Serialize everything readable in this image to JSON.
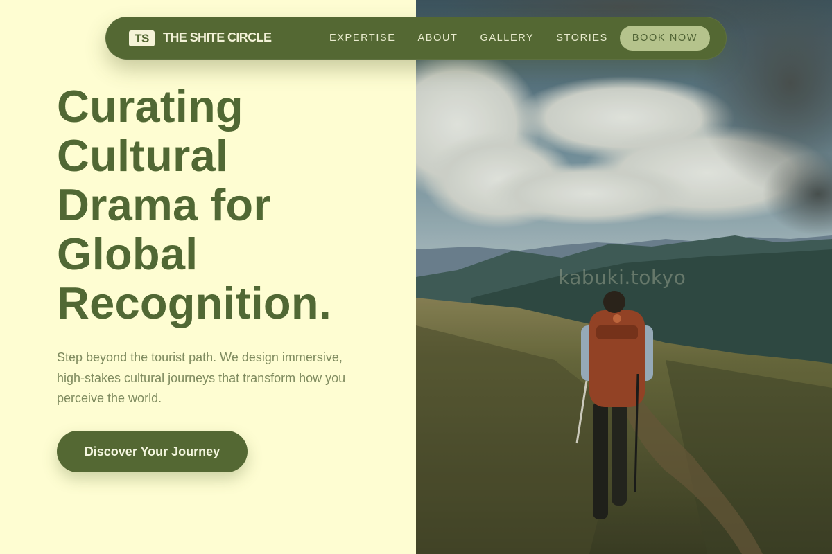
{
  "nav": {
    "logo_initials": "TS",
    "brand": "THE SHITE CIRCLE",
    "links": [
      "EXPERTISE",
      "ABOUT",
      "GALLERY",
      "STORIES"
    ],
    "book_label": "BOOK NOW"
  },
  "hero": {
    "headline_lines": [
      "Curating",
      "Cultural",
      "Drama for",
      "Global",
      "Recognition."
    ],
    "subtext": "Step beyond the tourist path. We design immersive, high-stakes cultural journeys that transform how you perceive the world.",
    "cta_label": "Discover Your Journey",
    "image_watermark": "kabuki.tokyo"
  },
  "colors": {
    "page_background": "#fefdd2",
    "brand_green": "#546833",
    "accent_sage": "#b5c38c",
    "text_muted": "#7f8b5f"
  }
}
